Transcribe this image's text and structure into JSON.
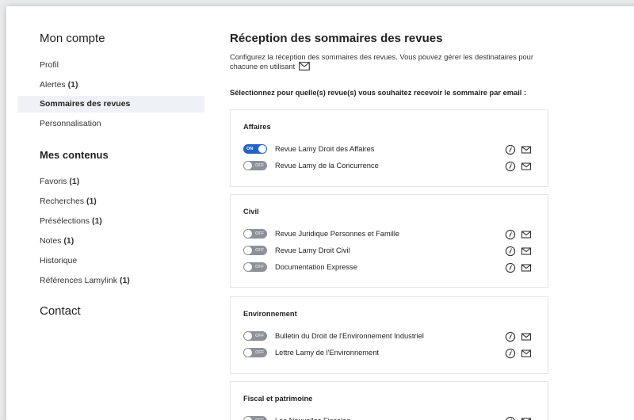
{
  "sidebar": {
    "section_account": "Mon compte",
    "account_items": [
      {
        "label": "Profil",
        "count": ""
      },
      {
        "label": "Alertes",
        "count": "(1)"
      },
      {
        "label": "Sommaires des revues",
        "count": ""
      },
      {
        "label": "Personnalisation",
        "count": ""
      }
    ],
    "section_contents": "Mes contenus",
    "content_items": [
      {
        "label": "Favoris",
        "count": "(1)"
      },
      {
        "label": "Recherches",
        "count": "(1)"
      },
      {
        "label": "Présélections",
        "count": "(1)"
      },
      {
        "label": "Notes",
        "count": "(1)"
      },
      {
        "label": "Historique",
        "count": ""
      },
      {
        "label": "Références Lamylink",
        "count": "(1)"
      }
    ],
    "section_contact": "Contact"
  },
  "main": {
    "title": "Réception des sommaires des revues",
    "intro": "Configurez la réception des sommaires des revues. Vous pouvez gérer les destinataires pour chacune en utilisant",
    "subtitle": "Sélectionnez pour quelle(s) revue(s) vous souhaitez recevoir le sommaire par email :",
    "toggle_on_label": "ON",
    "toggle_off_label": "OFF",
    "categories": [
      {
        "name": "Affaires",
        "reviews": [
          {
            "label": "Revue Lamy Droit des Affaires",
            "on": true
          },
          {
            "label": "Revue Lamy de la Concurrence",
            "on": false
          }
        ]
      },
      {
        "name": "Civil",
        "reviews": [
          {
            "label": "Revue Juridique Personnes et Famille",
            "on": false
          },
          {
            "label": "Revue Lamy Droit Civil",
            "on": false
          },
          {
            "label": "Documentation Expresse",
            "on": false
          }
        ]
      },
      {
        "name": "Environnement",
        "reviews": [
          {
            "label": "Bulletin du Droit de l'Environnement Industriel",
            "on": false
          },
          {
            "label": "Lettre Lamy de l'Environnement",
            "on": false
          }
        ]
      },
      {
        "name": "Fiscal et patrimoine",
        "reviews": [
          {
            "label": "Les Nouvelles Fiscales",
            "on": false
          }
        ]
      }
    ]
  },
  "colors": {
    "toggle_on": "#2362c8",
    "toggle_off": "#8e9197",
    "active_bg": "#eef1f6"
  },
  "icons": {
    "info": "info-circle-icon",
    "mail": "envelope-icon"
  }
}
